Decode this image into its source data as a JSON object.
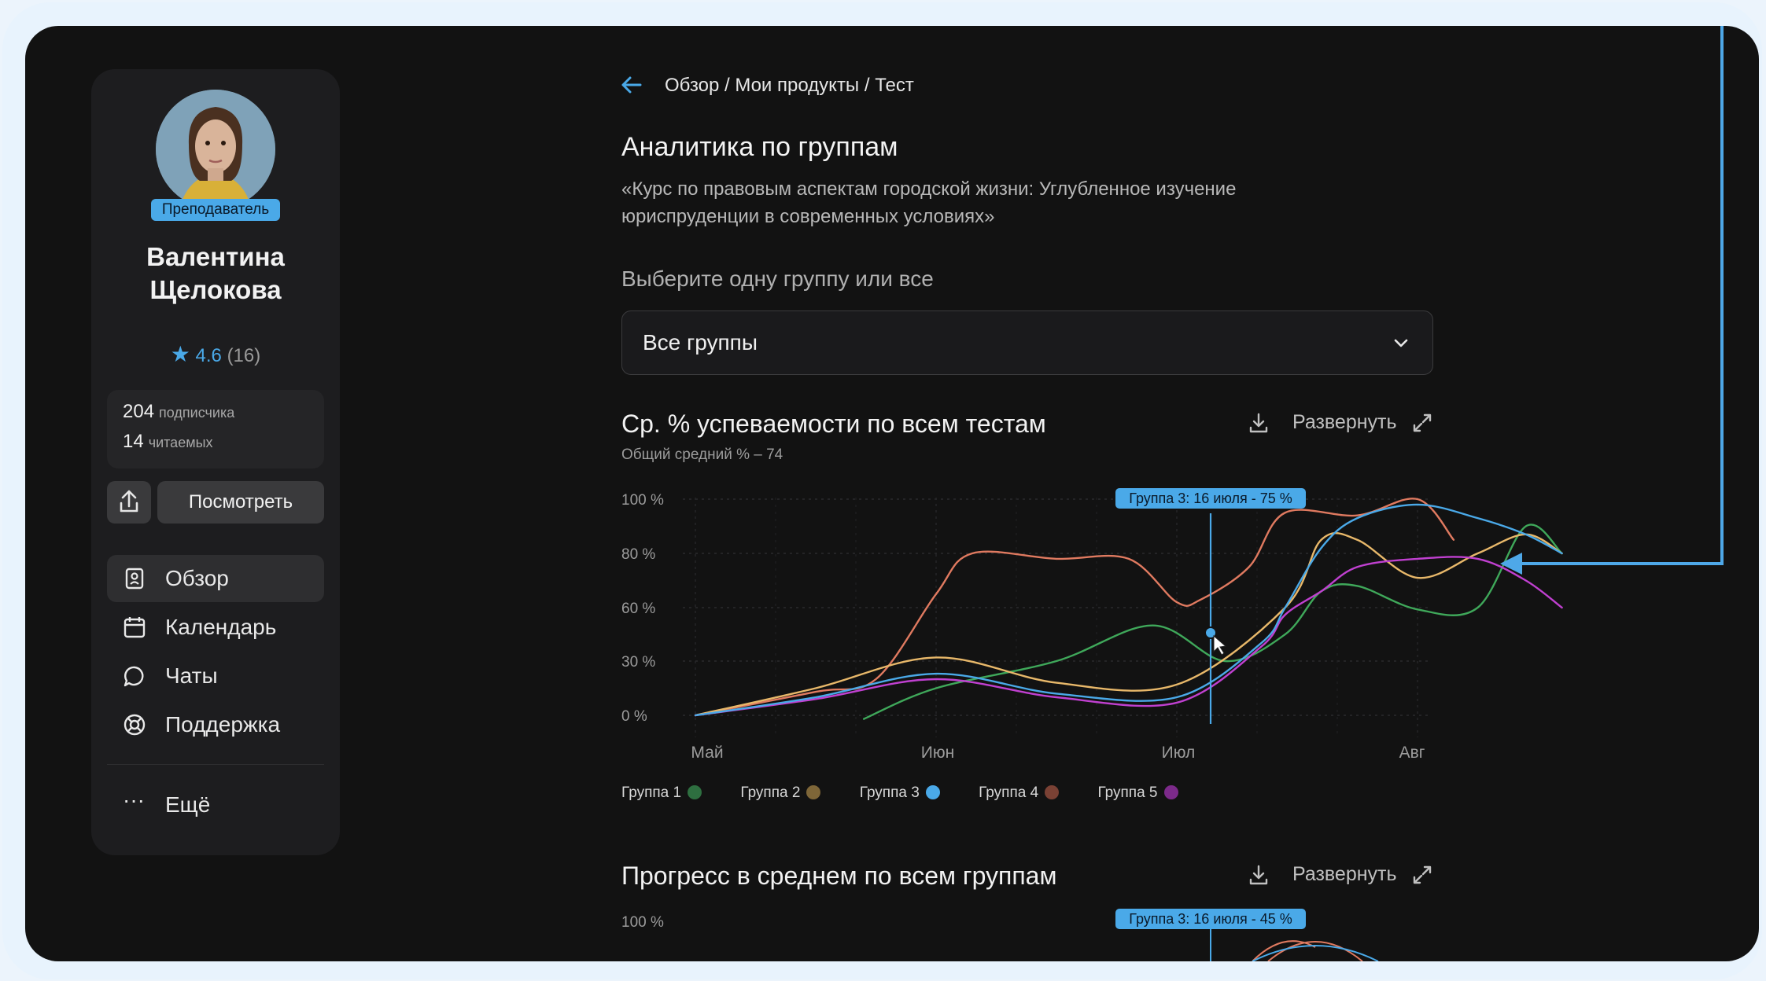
{
  "sidebar": {
    "role_badge": "Преподаватель",
    "name": "Валентина Щелокова",
    "rating": "4.6",
    "rating_count": "(16)",
    "subscribers_count": "204",
    "subscribers_label": "подписчика",
    "reading_count": "14",
    "reading_label": "читаемых",
    "view_button": "Посмотреть",
    "nav": [
      {
        "label": "Обзор",
        "icon": "overview-icon",
        "active": true
      },
      {
        "label": "Календарь",
        "icon": "calendar-icon",
        "active": false
      },
      {
        "label": "Чаты",
        "icon": "chat-icon",
        "active": false
      },
      {
        "label": "Поддержка",
        "icon": "support-icon",
        "active": false
      }
    ],
    "more": "Ещё"
  },
  "breadcrumb": "Обзор / Мои продукты / Тест",
  "page": {
    "title": "Аналитика по группам",
    "subtitle": "«Курс по правовым аспектам городской жизни: Углубленное изучение юриспруденции в современных условиях»",
    "select_label": "Выберите одну группу или все",
    "select_value": "Все группы"
  },
  "colors": {
    "accent": "#4aa9e8",
    "group1": "#3fa85a",
    "group2": "#e8b86a",
    "group3": "#4aa9e8",
    "group4": "#e07a60",
    "group5": "#c040d0"
  },
  "chart1": {
    "title": "Ср. % успеваемости по всем тестам",
    "subtitle": "Общий средний % – 74",
    "expand_label": "Развернуть",
    "tooltip": "Группа 3: 16 июля - 75 %"
  },
  "chart2": {
    "title": "Прогресс в среднем по всем группам",
    "expand_label": "Развернуть",
    "tooltip": "Группа 3: 16 июля - 45 %",
    "y_top": "100 %"
  },
  "legend": [
    "Группа 1",
    "Группа 2",
    "Группа 3",
    "Группа 4",
    "Группа 5"
  ],
  "chart_data": {
    "type": "line",
    "title": "Ср. % успеваемости по всем тестам",
    "subtitle": "Общий средний % – 74",
    "x_ticks": [
      "Май",
      "Июн",
      "Июл",
      "Авг"
    ],
    "y_ticks": [
      "100 %",
      "80 %",
      "60 %",
      "30 %",
      "0 %"
    ],
    "grid": true,
    "legend_position": "bottom",
    "series": [
      {
        "name": "Группа 1",
        "color": "#3fa85a",
        "x": [
          0.7,
          1.0,
          1.5,
          1.9,
          2.2,
          2.45,
          2.6,
          2.75,
          3.0,
          3.25,
          3.45,
          3.6
        ],
        "y": [
          -2,
          15,
          30,
          50,
          30,
          45,
          66,
          68,
          59,
          60,
          90,
          80
        ]
      },
      {
        "name": "Группа 2",
        "color": "#e8b86a",
        "x": [
          0.0,
          0.5,
          1.0,
          1.5,
          2.0,
          2.45,
          2.6,
          2.75,
          3.0,
          3.25,
          3.45,
          3.6
        ],
        "y": [
          0,
          15,
          32,
          18,
          17,
          60,
          85,
          85,
          71,
          80,
          87,
          80
        ]
      },
      {
        "name": "Группа 3",
        "color": "#4aa9e8",
        "x": [
          0.0,
          0.5,
          1.0,
          1.5,
          2.0,
          2.35,
          2.45,
          2.6,
          2.75,
          3.0,
          3.25,
          3.45,
          3.6
        ],
        "y": [
          0,
          10,
          23,
          12,
          10,
          40,
          60,
          82,
          93,
          98,
          93,
          87,
          80
        ]
      },
      {
        "name": "Группа 4",
        "color": "#e07a60",
        "x": [
          0.0,
          0.5,
          0.75,
          1.0,
          1.15,
          1.5,
          1.8,
          2.0,
          2.1,
          2.3,
          2.45,
          2.75,
          3.0,
          3.15
        ],
        "y": [
          0,
          13,
          20,
          65,
          80,
          78,
          78,
          62,
          63,
          75,
          95,
          94,
          100,
          85
        ]
      },
      {
        "name": "Группа 5",
        "color": "#c040d0",
        "x": [
          0.0,
          0.5,
          1.0,
          1.5,
          2.0,
          2.35,
          2.45,
          2.6,
          2.75,
          3.0,
          3.25,
          3.45,
          3.6
        ],
        "y": [
          0,
          9,
          20,
          10,
          7,
          38,
          56,
          66,
          75,
          78,
          78,
          70,
          60
        ]
      }
    ]
  }
}
